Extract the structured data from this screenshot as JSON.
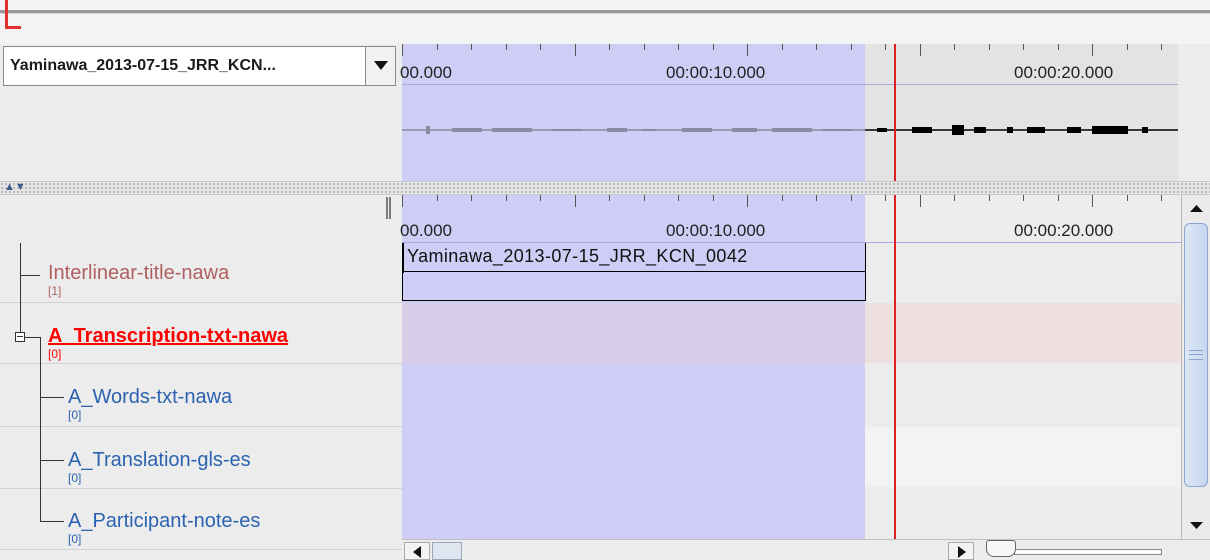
{
  "media": {
    "selected_file": "Yaminawa_2013-07-15_JRR_KCN..."
  },
  "signal_ruler": {
    "labels": [
      "00.000",
      "00:00:10.000",
      "00:00:20.000"
    ]
  },
  "timeline_ruler": {
    "labels": [
      "00.000",
      "00:00:10.000",
      "00:00:20.000"
    ]
  },
  "annotation": {
    "text": "Yaminawa_2013-07-15_JRR_KCN_0042"
  },
  "tiers": [
    {
      "name": "Interlinear-title-nawa",
      "count": "[1]",
      "color": "#b06060"
    },
    {
      "name": "A_Transcription-txt-nawa",
      "count": "[0]",
      "color": "#ff0000",
      "active": true
    },
    {
      "name": "A_Words-txt-nawa",
      "count": "[0]",
      "color": "#2b63b0"
    },
    {
      "name": "A_Translation-gls-es",
      "count": "[0]",
      "color": "#2b63b0"
    },
    {
      "name": "A_Participant-note-es",
      "count": "[0]",
      "color": "#2b63b0"
    }
  ],
  "colors": {
    "selection": "#cdcdf6",
    "crosshair": "#e02020",
    "active_tier_row": "#f0dede"
  }
}
